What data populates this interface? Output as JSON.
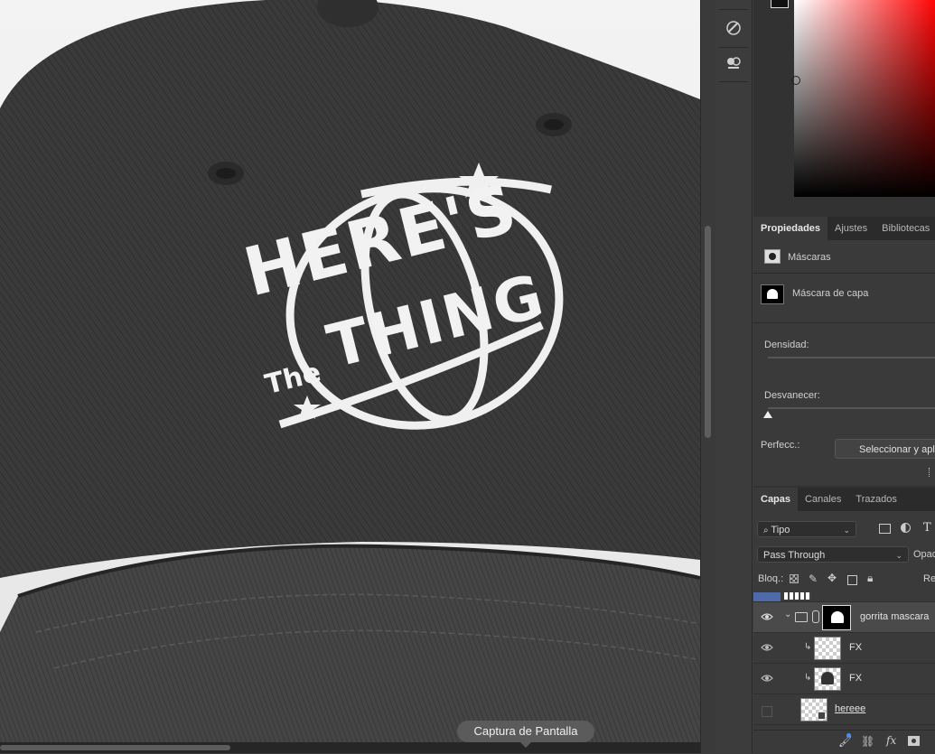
{
  "canvas": {
    "artwork": {
      "line1": "HERE'S",
      "line2": "The",
      "line3": "THING"
    },
    "tooltip": "Captura de Pantalla"
  },
  "properties_panel": {
    "tabs": [
      {
        "label": "Propiedades",
        "active": true
      },
      {
        "label": "Ajustes",
        "active": false
      },
      {
        "label": "Bibliotecas",
        "active": false
      }
    ],
    "masks_label": "Máscaras",
    "layer_mask_label": "Máscara de capa",
    "density_label": "Densidad:",
    "feather_label": "Desvanecer:",
    "refine_label": "Perfecc.:",
    "select_mask_button": "Seleccionar y aplicar"
  },
  "layers_panel": {
    "tabs": [
      {
        "label": "Capas",
        "active": true
      },
      {
        "label": "Canales",
        "active": false
      },
      {
        "label": "Trazados",
        "active": false
      }
    ],
    "filter_kind": "Tipo",
    "blend_mode": "Pass Through",
    "opacity_label": "Opac",
    "lock_label": "Bloq.:",
    "fill_label": "Re",
    "layers": [
      {
        "name": "gorrita mascara",
        "type": "group",
        "visible": true,
        "selected": true
      },
      {
        "name": "FX",
        "type": "clipped",
        "visible": true,
        "selected": false
      },
      {
        "name": "FX",
        "type": "clipped",
        "visible": true,
        "selected": false
      },
      {
        "name": "hereee",
        "type": "smart-object",
        "visible": false,
        "selected": false
      }
    ]
  },
  "colors": {
    "panel_bg": "#3a3a3a",
    "selected_layer": "#4a4a4a",
    "cap": "#3d3d3d",
    "embroidery": "#f2f2f2",
    "accent_blue": "#4f6aa8"
  }
}
